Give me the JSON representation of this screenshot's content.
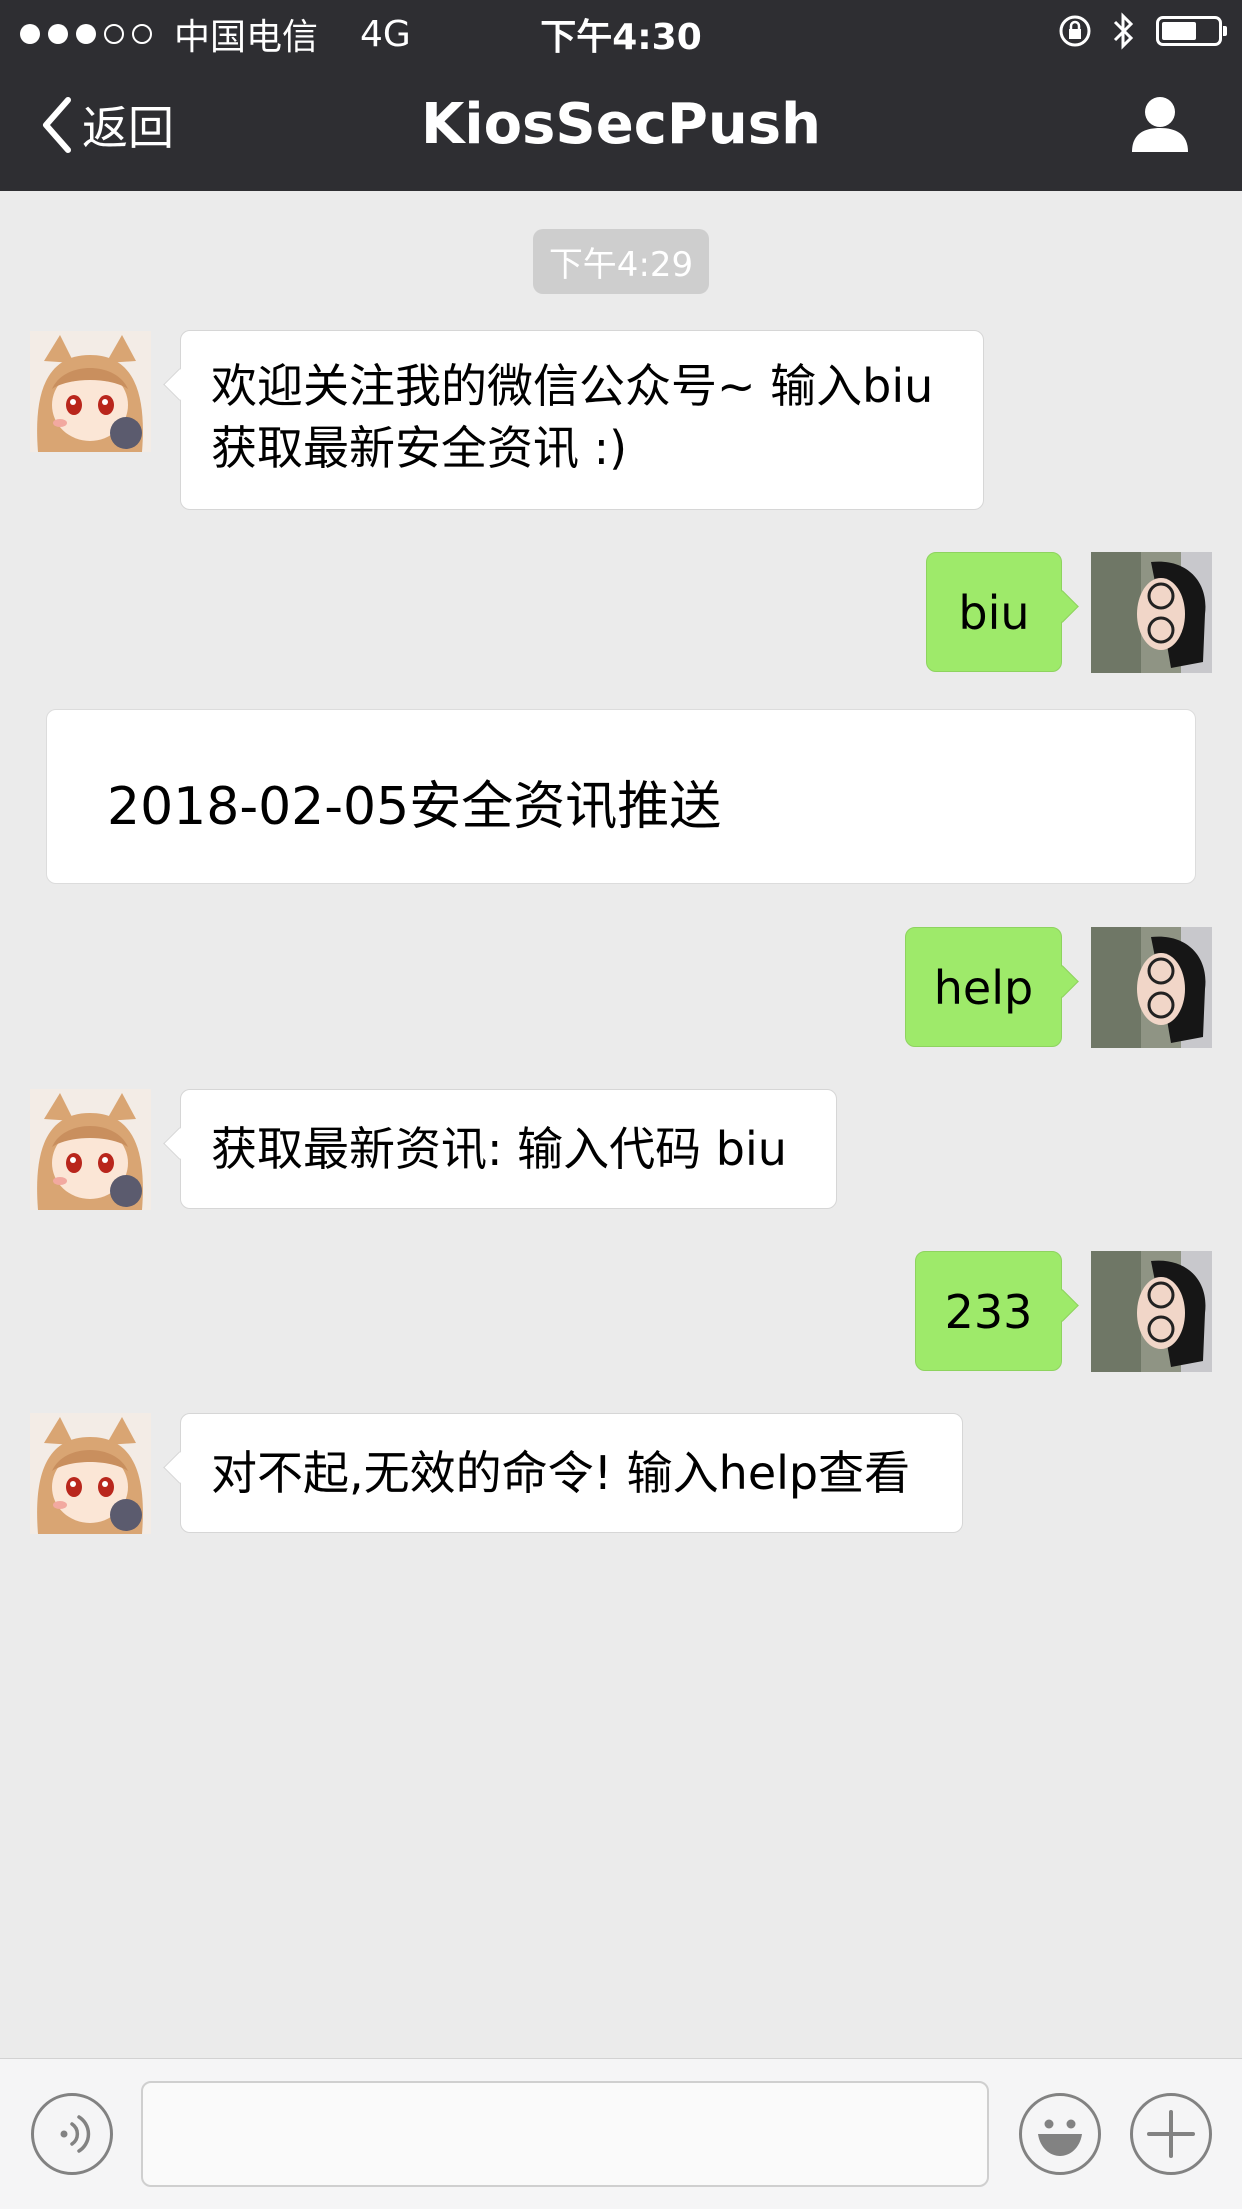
{
  "status_bar": {
    "carrier": "中国电信",
    "network": "4G",
    "time": "下午4:30"
  },
  "nav": {
    "back_label": "返回",
    "title": "KiosSecPush"
  },
  "chat": {
    "timestamp": "下午4:29",
    "messages": [
      {
        "from": "bot",
        "line1": "欢迎关注我的微信公众号~ 输入biu",
        "line2": "获取最新安全资讯 :)"
      },
      {
        "from": "me",
        "text": "biu"
      },
      {
        "from": "bot_card",
        "text": "2018-02-05安全资讯推送"
      },
      {
        "from": "me",
        "text": "help"
      },
      {
        "from": "bot",
        "text": "获取最新资讯: 输入代码 biu"
      },
      {
        "from": "me",
        "text": "233"
      },
      {
        "from": "bot",
        "text": "对不起,无效的命令! 输入help查看"
      }
    ]
  },
  "input": {
    "value": ""
  },
  "colors": {
    "header_bg": "#2e2e32",
    "chat_bg": "#ebebeb",
    "sent_bubble": "#9eea6a",
    "received_bubble": "#ffffff"
  },
  "icons": [
    "back-chevron-icon",
    "profile-icon",
    "voice-icon",
    "emoji-icon",
    "plus-icon",
    "bluetooth-icon",
    "orientation-lock-icon",
    "battery-icon",
    "signal-icon"
  ]
}
